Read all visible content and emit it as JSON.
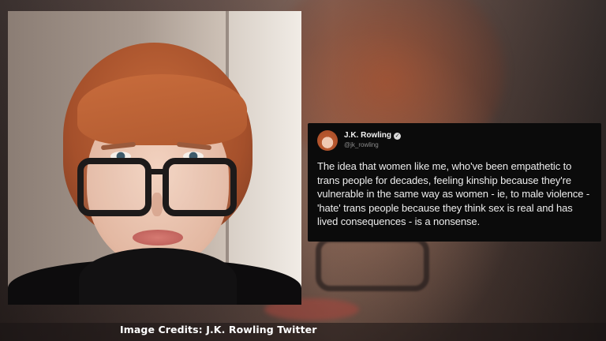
{
  "tweet": {
    "name": "J.K. Rowling",
    "handle": "@jk_rowling",
    "verified_icon": "verified-badge-icon",
    "text": "The idea that women like me, who've been empathetic to trans people for decades, feeling kinship because they're vulnerable in the same way as women - ie, to male violence - 'hate' trans people because they think sex is real and has lived consequences - is a nonsense."
  },
  "caption": {
    "text": "Image Credits: J.K. Rowling Twitter"
  },
  "colors": {
    "tweet_background": "#0b0b0b",
    "tweet_text": "#ededed",
    "caption_text": "#ffffff"
  }
}
